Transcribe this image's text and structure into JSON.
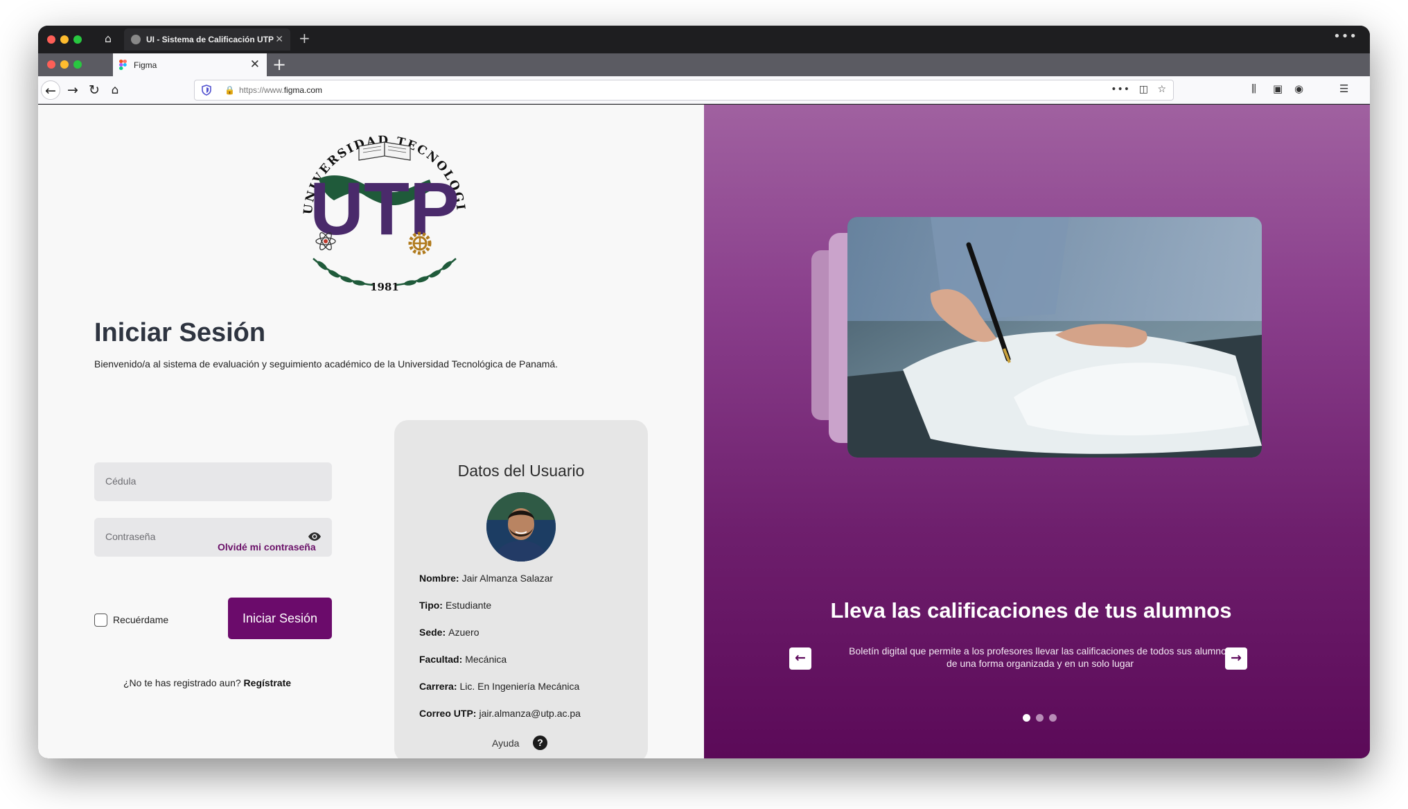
{
  "outer_window": {
    "tab_title": "UI - Sistema de Calificación UTP",
    "close_glyph": "✕",
    "new_tab_glyph": "+",
    "more_glyph": "•••"
  },
  "browser": {
    "tab_title": "Figma",
    "tab_close_glyph": "✕",
    "new_tab_glyph": "+",
    "url_prefix": "https://www.",
    "url_domain": "figma.com"
  },
  "logo": {
    "ring_text": "UNIVERSIDAD TECNOLOGICA DE PANAMA",
    "monogram": "UTP",
    "year": "1981"
  },
  "login": {
    "title": "Iniciar Sesión",
    "subtitle": "Bienvenido/a al sistema de evaluación y seguimiento académico de la Universidad Tecnológica de Panamá.",
    "id_placeholder": "Cédula",
    "password_placeholder": "Contraseña",
    "forgot_label": "Olvidé mi contraseña",
    "remember_label": "Recuérdame",
    "remember_checked": false,
    "submit_label": "Iniciar Sesión",
    "register_prompt": "¿No te has registrado aun?",
    "register_link": "Regístrate"
  },
  "user_card": {
    "title": "Datos del Usuario",
    "fields": [
      {
        "label": "Nombre:",
        "value": "Jair Almanza Salazar"
      },
      {
        "label": "Tipo:",
        "value": "Estudiante"
      },
      {
        "label": "Sede:",
        "value": "Azuero"
      },
      {
        "label": "Facultad:",
        "value": "Mecánica"
      },
      {
        "label": "Carrera:",
        "value": "Lic. En Ingeniería Mecánica"
      },
      {
        "label": "Correo UTP:",
        "value": "jair.almanza@utp.ac.pa"
      }
    ],
    "help_label": "Ayuda",
    "help_glyph": "?"
  },
  "hero": {
    "title": "Lleva las calificaciones de tus alumnos",
    "subtitle": "Boletín digital que permite a los profesores llevar las calificaciones de todos sus alumnos de una forma organizada y en un solo lugar",
    "prev_glyph": "←",
    "next_glyph": "→",
    "slide_count": 3,
    "active_slide": 1
  },
  "colors": {
    "brand_purple": "#6b0b6b",
    "logo_purple": "#4a2a6b",
    "logo_green": "#1f5a3a",
    "card_bg": "#e6e6e6",
    "page_bg": "#f8f8f8"
  },
  "icons": [
    "home-icon",
    "back-icon",
    "forward-icon",
    "reload-icon",
    "shield-icon",
    "lock-icon",
    "pocket-icon",
    "star-icon",
    "library-icon",
    "sidebar-icon",
    "account-icon",
    "menu-icon",
    "eye-icon",
    "help-icon",
    "arrow-left-icon",
    "arrow-right-icon",
    "figma-icon"
  ]
}
